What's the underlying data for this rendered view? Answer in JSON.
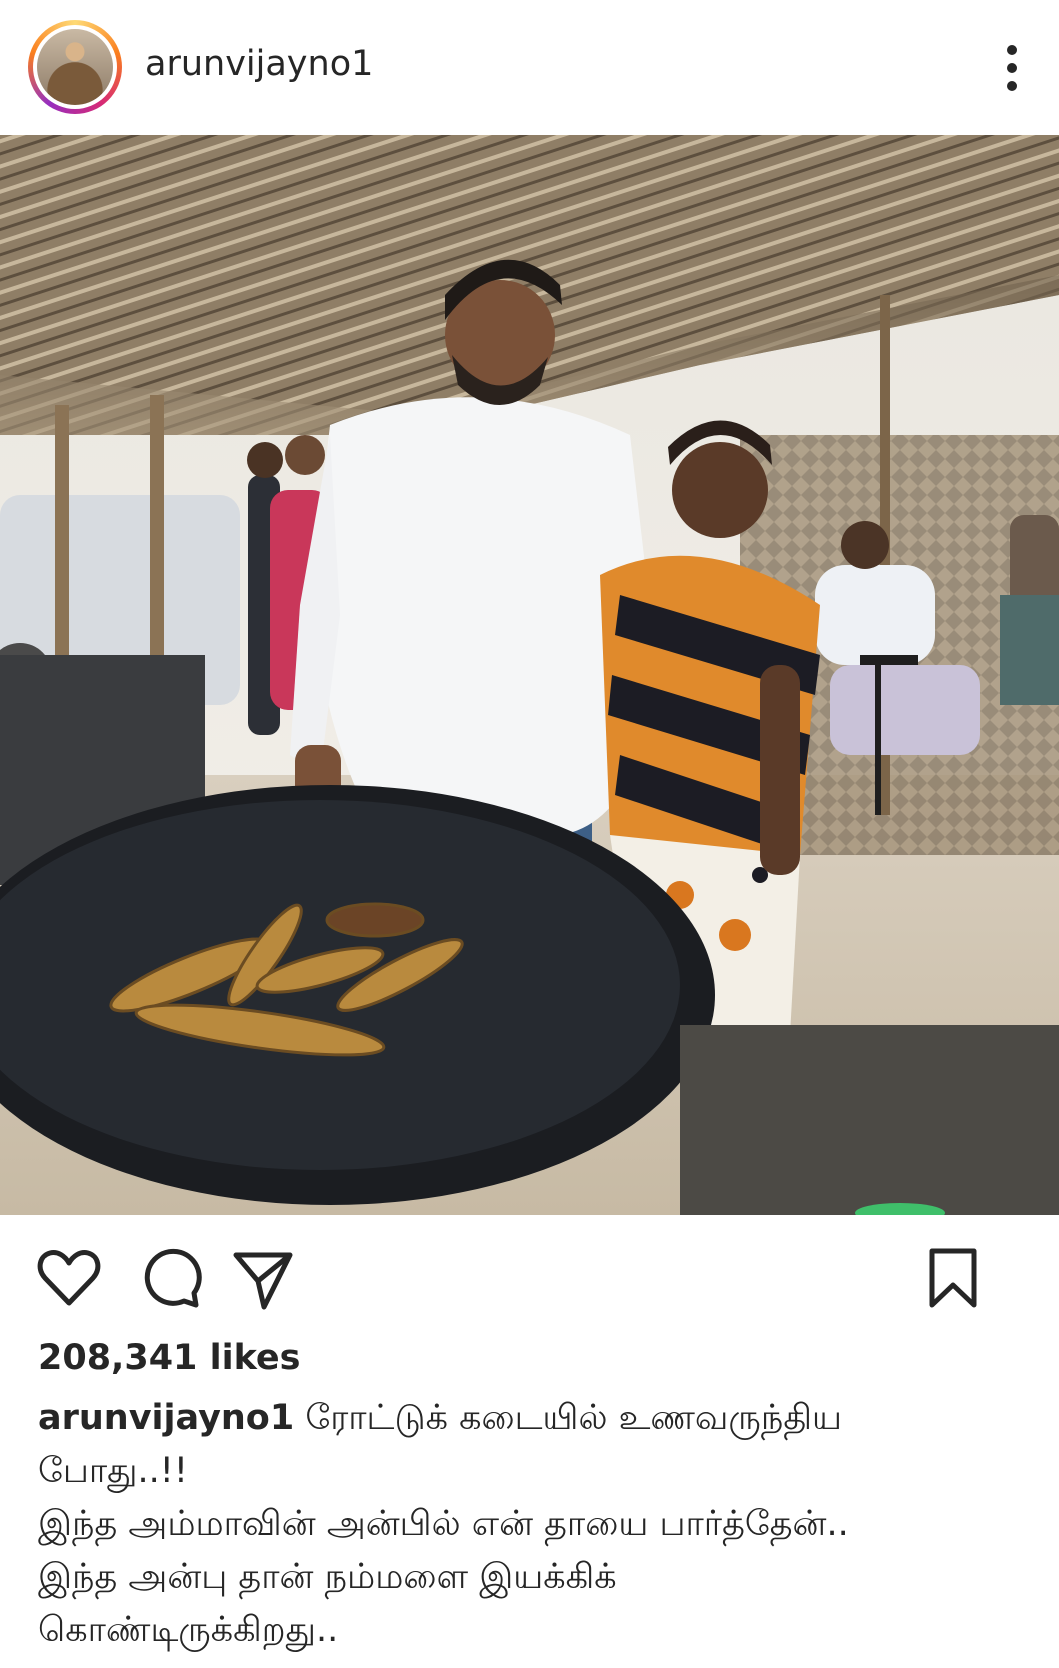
{
  "post": {
    "username": "arunvijayno1",
    "likes": "208,341 likes",
    "caption": {
      "user": "arunvijayno1",
      "line1": "ரோட்டுக் கடையில் உணவருந்திய",
      "line2": "போது..!!",
      "line3": "இந்த அம்மாவின் அன்பில் என் தாயை பார்த்தேன்..",
      "line4": "இந்த அன்பு தான் நம்மளை இயக்கிக்",
      "line5": "கொண்டிருக்கிறது.."
    }
  },
  "icons": {
    "more": "more-options-icon",
    "like": "heart-icon",
    "comment": "comment-icon",
    "share": "send-icon",
    "save": "bookmark-icon"
  },
  "colors": {
    "text": "#262626",
    "ring_start": "#feda75",
    "ring_end": "#d62976"
  }
}
